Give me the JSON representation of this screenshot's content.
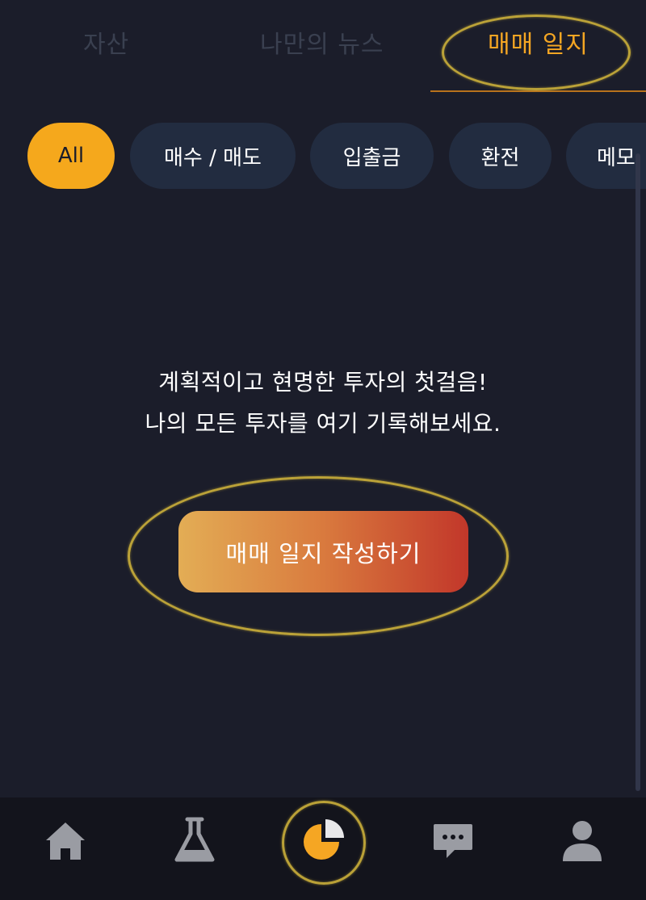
{
  "tabs": [
    {
      "label": "자산",
      "active": false
    },
    {
      "label": "나만의 뉴스",
      "active": false
    },
    {
      "label": "매매 일지",
      "active": true
    }
  ],
  "filters": [
    {
      "label": "All",
      "active": true
    },
    {
      "label": "매수 / 매도",
      "active": false
    },
    {
      "label": "입출금",
      "active": false
    },
    {
      "label": "환전",
      "active": false
    },
    {
      "label": "메모",
      "active": false
    }
  ],
  "empty_state": {
    "line1": "계획적이고 현명한 투자의 첫걸음!",
    "line2": "나의 모든 투자를 여기 기록해보세요."
  },
  "cta": {
    "label": "매매 일지 작성하기"
  },
  "bottom_nav": [
    {
      "icon": "home-icon",
      "active": false
    },
    {
      "icon": "flask-icon",
      "active": false
    },
    {
      "icon": "pie-chart-icon",
      "active": true
    },
    {
      "icon": "chat-bubble-icon",
      "active": false
    },
    {
      "icon": "user-icon",
      "active": false
    }
  ],
  "colors": {
    "background": "#1b1d2a",
    "accent": "#f5a623",
    "chip_bg": "#222c40",
    "nav_bg": "#13141c",
    "icon_inactive": "#9a9ca3",
    "annotation": "#cdb13a"
  }
}
